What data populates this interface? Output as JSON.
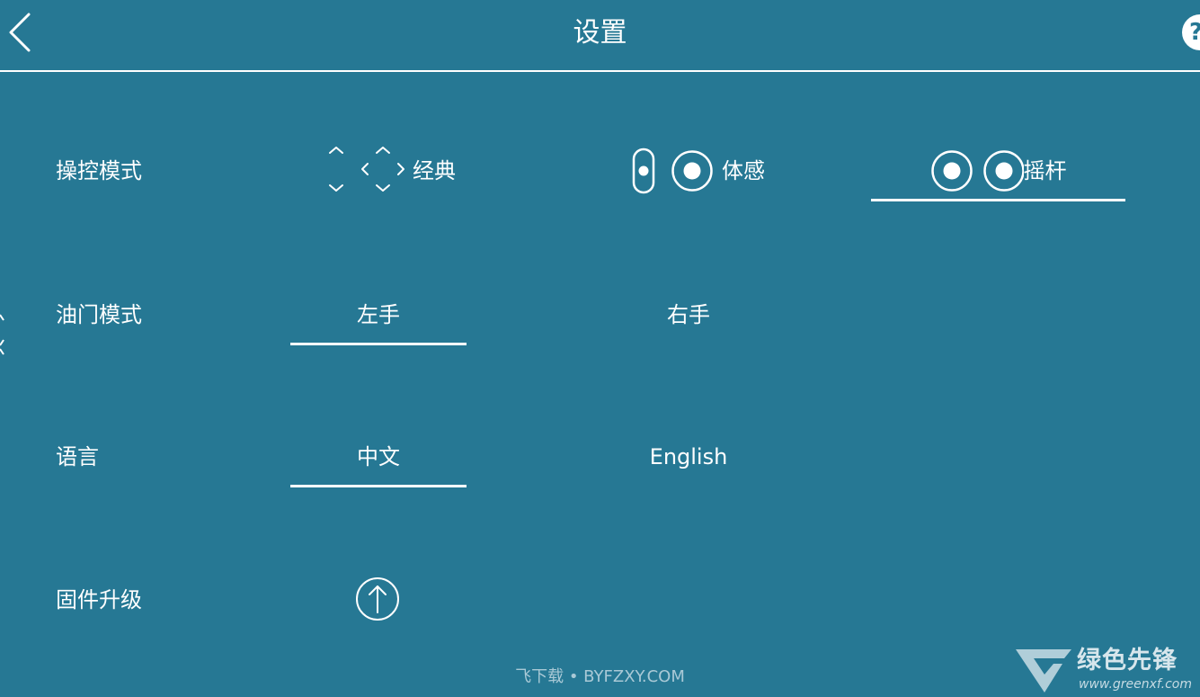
{
  "header": {
    "title": "设置",
    "help_label": "?"
  },
  "rows": {
    "control_mode": {
      "label": "操控模式",
      "options": [
        "经典",
        "体感",
        "摇杆"
      ],
      "selected": "摇杆"
    },
    "throttle_mode": {
      "label": "油门模式",
      "options": [
        "左手",
        "右手"
      ],
      "selected": "左手"
    },
    "language": {
      "label": "语言",
      "options": [
        "中文",
        "English"
      ],
      "selected": "中文"
    },
    "firmware": {
      "label": "固件升级"
    }
  },
  "watermark": "飞下载 • BYFZXY.COM",
  "brand": {
    "name": "绿色先锋",
    "url": "www.greenxf.com"
  },
  "colors": {
    "background": "#267894",
    "foreground": "#ffffff"
  },
  "icons": {
    "back": "chevron-left-icon",
    "help": "help-icon",
    "classic": "dpad-icon",
    "motion": "phone-tilt-icon",
    "joystick": "dual-joystick-icon",
    "firmware": "upload-arrow-icon"
  }
}
